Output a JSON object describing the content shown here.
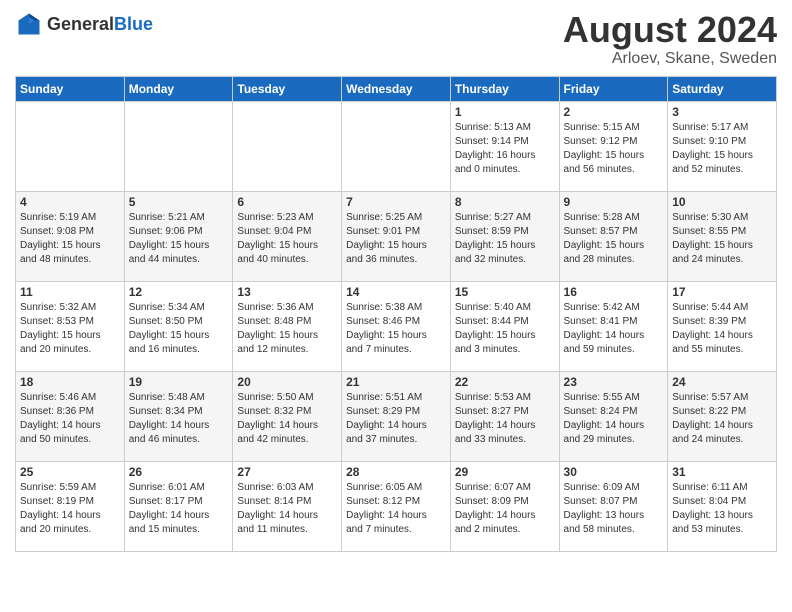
{
  "header": {
    "logo_general": "General",
    "logo_blue": "Blue",
    "month_year": "August 2024",
    "location": "Arloev, Skane, Sweden"
  },
  "days_of_week": [
    "Sunday",
    "Monday",
    "Tuesday",
    "Wednesday",
    "Thursday",
    "Friday",
    "Saturday"
  ],
  "weeks": [
    [
      {
        "day": "",
        "info": ""
      },
      {
        "day": "",
        "info": ""
      },
      {
        "day": "",
        "info": ""
      },
      {
        "day": "",
        "info": ""
      },
      {
        "day": "1",
        "info": "Sunrise: 5:13 AM\nSunset: 9:14 PM\nDaylight: 16 hours\nand 0 minutes."
      },
      {
        "day": "2",
        "info": "Sunrise: 5:15 AM\nSunset: 9:12 PM\nDaylight: 15 hours\nand 56 minutes."
      },
      {
        "day": "3",
        "info": "Sunrise: 5:17 AM\nSunset: 9:10 PM\nDaylight: 15 hours\nand 52 minutes."
      }
    ],
    [
      {
        "day": "4",
        "info": "Sunrise: 5:19 AM\nSunset: 9:08 PM\nDaylight: 15 hours\nand 48 minutes."
      },
      {
        "day": "5",
        "info": "Sunrise: 5:21 AM\nSunset: 9:06 PM\nDaylight: 15 hours\nand 44 minutes."
      },
      {
        "day": "6",
        "info": "Sunrise: 5:23 AM\nSunset: 9:04 PM\nDaylight: 15 hours\nand 40 minutes."
      },
      {
        "day": "7",
        "info": "Sunrise: 5:25 AM\nSunset: 9:01 PM\nDaylight: 15 hours\nand 36 minutes."
      },
      {
        "day": "8",
        "info": "Sunrise: 5:27 AM\nSunset: 8:59 PM\nDaylight: 15 hours\nand 32 minutes."
      },
      {
        "day": "9",
        "info": "Sunrise: 5:28 AM\nSunset: 8:57 PM\nDaylight: 15 hours\nand 28 minutes."
      },
      {
        "day": "10",
        "info": "Sunrise: 5:30 AM\nSunset: 8:55 PM\nDaylight: 15 hours\nand 24 minutes."
      }
    ],
    [
      {
        "day": "11",
        "info": "Sunrise: 5:32 AM\nSunset: 8:53 PM\nDaylight: 15 hours\nand 20 minutes."
      },
      {
        "day": "12",
        "info": "Sunrise: 5:34 AM\nSunset: 8:50 PM\nDaylight: 15 hours\nand 16 minutes."
      },
      {
        "day": "13",
        "info": "Sunrise: 5:36 AM\nSunset: 8:48 PM\nDaylight: 15 hours\nand 12 minutes."
      },
      {
        "day": "14",
        "info": "Sunrise: 5:38 AM\nSunset: 8:46 PM\nDaylight: 15 hours\nand 7 minutes."
      },
      {
        "day": "15",
        "info": "Sunrise: 5:40 AM\nSunset: 8:44 PM\nDaylight: 15 hours\nand 3 minutes."
      },
      {
        "day": "16",
        "info": "Sunrise: 5:42 AM\nSunset: 8:41 PM\nDaylight: 14 hours\nand 59 minutes."
      },
      {
        "day": "17",
        "info": "Sunrise: 5:44 AM\nSunset: 8:39 PM\nDaylight: 14 hours\nand 55 minutes."
      }
    ],
    [
      {
        "day": "18",
        "info": "Sunrise: 5:46 AM\nSunset: 8:36 PM\nDaylight: 14 hours\nand 50 minutes."
      },
      {
        "day": "19",
        "info": "Sunrise: 5:48 AM\nSunset: 8:34 PM\nDaylight: 14 hours\nand 46 minutes."
      },
      {
        "day": "20",
        "info": "Sunrise: 5:50 AM\nSunset: 8:32 PM\nDaylight: 14 hours\nand 42 minutes."
      },
      {
        "day": "21",
        "info": "Sunrise: 5:51 AM\nSunset: 8:29 PM\nDaylight: 14 hours\nand 37 minutes."
      },
      {
        "day": "22",
        "info": "Sunrise: 5:53 AM\nSunset: 8:27 PM\nDaylight: 14 hours\nand 33 minutes."
      },
      {
        "day": "23",
        "info": "Sunrise: 5:55 AM\nSunset: 8:24 PM\nDaylight: 14 hours\nand 29 minutes."
      },
      {
        "day": "24",
        "info": "Sunrise: 5:57 AM\nSunset: 8:22 PM\nDaylight: 14 hours\nand 24 minutes."
      }
    ],
    [
      {
        "day": "25",
        "info": "Sunrise: 5:59 AM\nSunset: 8:19 PM\nDaylight: 14 hours\nand 20 minutes."
      },
      {
        "day": "26",
        "info": "Sunrise: 6:01 AM\nSunset: 8:17 PM\nDaylight: 14 hours\nand 15 minutes."
      },
      {
        "day": "27",
        "info": "Sunrise: 6:03 AM\nSunset: 8:14 PM\nDaylight: 14 hours\nand 11 minutes."
      },
      {
        "day": "28",
        "info": "Sunrise: 6:05 AM\nSunset: 8:12 PM\nDaylight: 14 hours\nand 7 minutes."
      },
      {
        "day": "29",
        "info": "Sunrise: 6:07 AM\nSunset: 8:09 PM\nDaylight: 14 hours\nand 2 minutes."
      },
      {
        "day": "30",
        "info": "Sunrise: 6:09 AM\nSunset: 8:07 PM\nDaylight: 13 hours\nand 58 minutes."
      },
      {
        "day": "31",
        "info": "Sunrise: 6:11 AM\nSunset: 8:04 PM\nDaylight: 13 hours\nand 53 minutes."
      }
    ]
  ]
}
